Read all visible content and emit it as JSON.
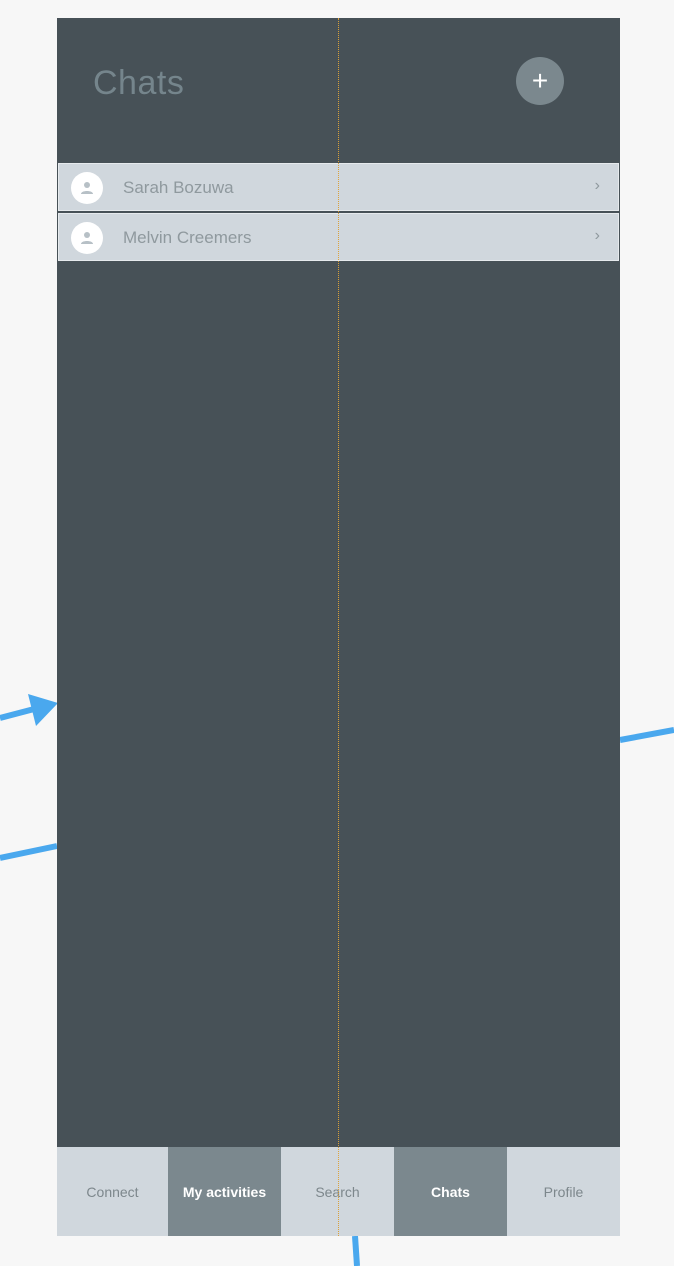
{
  "header": {
    "title": "Chats",
    "add_label": "+"
  },
  "chats": [
    {
      "name": "Sarah Bozuwa",
      "chevron": "›"
    },
    {
      "name": "Melvin Creemers",
      "chevron": "›"
    }
  ],
  "tabs": [
    {
      "label": "Connect"
    },
    {
      "label": "My activities"
    },
    {
      "label": "Search"
    },
    {
      "label": "Chats"
    },
    {
      "label": "Profile"
    }
  ],
  "colors": {
    "panel": "#475157",
    "row": "#d0d7dd",
    "accent_tab": "#7b888e",
    "arrow": "#4aa8ee",
    "guide": "#d9a03a"
  }
}
